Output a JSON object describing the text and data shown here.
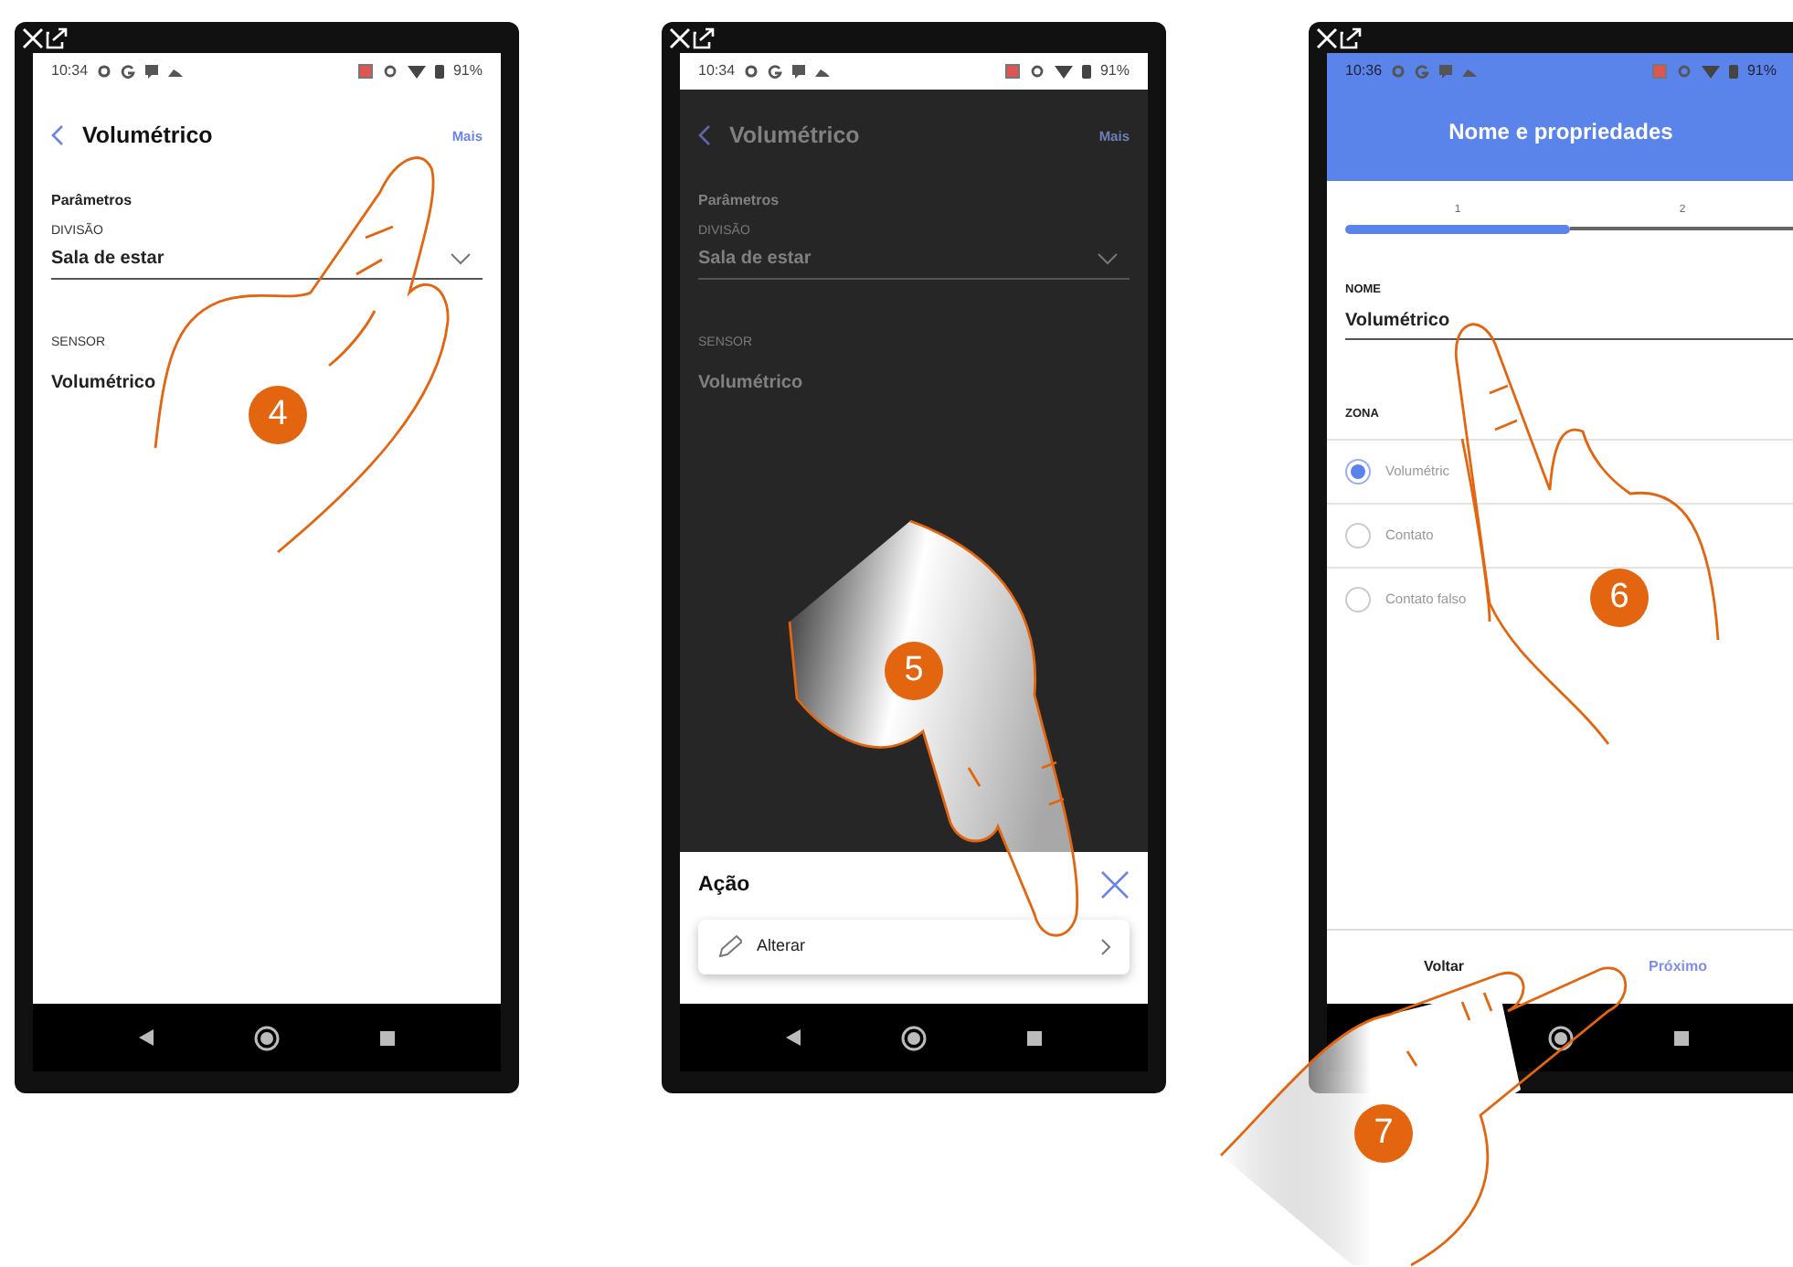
{
  "steps": [
    {
      "kind": "details",
      "badge": "4",
      "dimmed": false,
      "status": {
        "time": "10:34",
        "battery": "91%"
      },
      "header": {
        "title": "Volumétrico",
        "action": "Mais"
      },
      "section": "Parâmetros",
      "fields": [
        {
          "kind": "dropdown",
          "label": "DIVISÃO",
          "value": "Sala de estar"
        },
        {
          "kind": "text",
          "label": "SENSOR",
          "value": "Volumétrico"
        }
      ]
    },
    {
      "kind": "details",
      "badge": "5",
      "dimmed": true,
      "status": {
        "time": "10:34",
        "battery": "91%"
      },
      "header": {
        "title": "Volumétrico",
        "action": "Mais"
      },
      "section": "Parâmetros",
      "fields": [
        {
          "kind": "dropdown",
          "label": "DIVISÃO",
          "value": "Sala de estar"
        },
        {
          "kind": "text",
          "label": "SENSOR",
          "value": "Volumétrico"
        }
      ],
      "sheet": {
        "title": "Ação",
        "items": [
          {
            "label": "Alterar"
          }
        ]
      }
    },
    {
      "kind": "wizard",
      "badge": "6",
      "status": {
        "time": "10:36",
        "battery": "91%"
      },
      "title": "Nome e propriedades",
      "stepper": [
        {
          "label": "1",
          "selected": true
        },
        {
          "label": "2",
          "selected": false
        }
      ],
      "name_field": {
        "label": "NOME",
        "value": "Volumétrico"
      },
      "zone": {
        "label": "ZONA",
        "options": [
          {
            "label": "Volumétric",
            "selected": true
          },
          {
            "label": "Contato",
            "selected": false
          },
          {
            "label": "Contato falso",
            "selected": false
          }
        ]
      },
      "buttons": [
        {
          "kind": "secondary",
          "label": "Voltar"
        },
        {
          "kind": "primary",
          "label": "Próximo"
        }
      ],
      "extra_badge": "7"
    }
  ]
}
